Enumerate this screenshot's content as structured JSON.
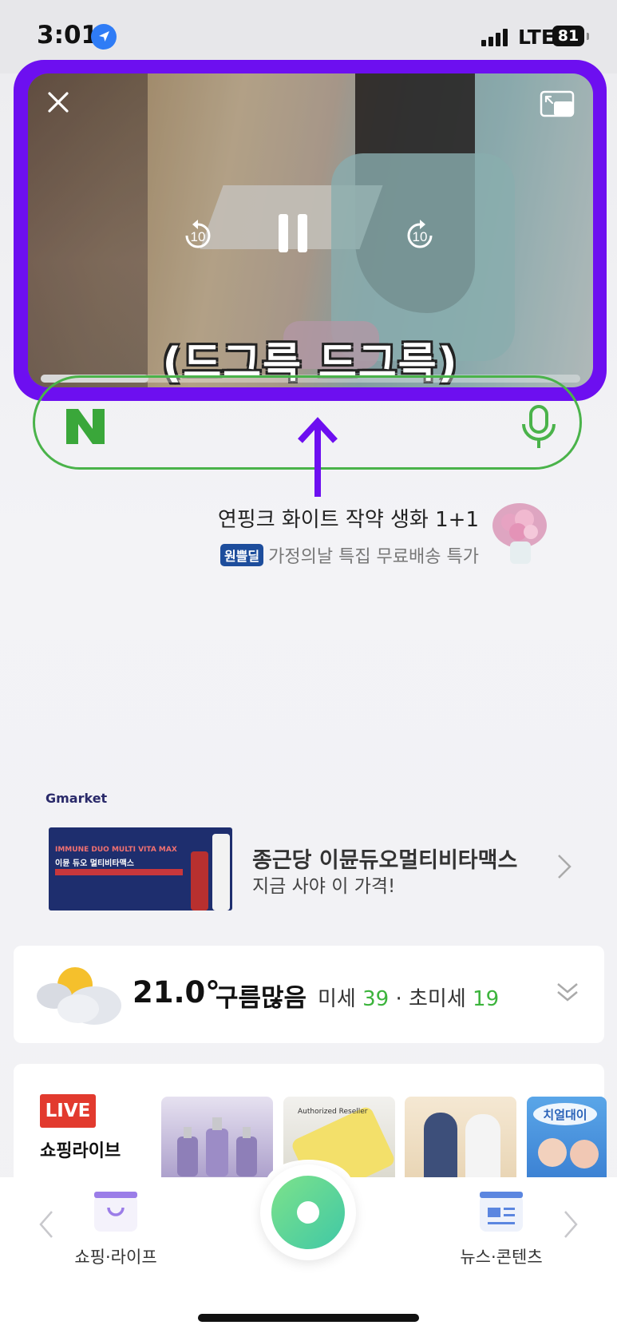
{
  "status_bar": {
    "time": "3:01",
    "network": "LTE",
    "battery": "81"
  },
  "pip": {
    "subtitle": "(드그륵 드그륵)",
    "rewind_label": "10",
    "forward_label": "10",
    "progress": 0.2
  },
  "search": {},
  "promo": {
    "title": "연핑크 화이트 작약 생화 1+1",
    "badge": "원쁠딜",
    "subtitle": "가정의날 특집 무료배송 특가"
  },
  "ad": {
    "brand": "Gmarket",
    "image_line1": "IMMUNE DUO MULTI VITA MAX",
    "image_line2": "이뮨 듀오 멀티비타맥스",
    "title": "종근당 이뮨듀오멀티비타맥스",
    "subtitle": "지금 사야 이 가격!"
  },
  "weather": {
    "temperature": "21.0°",
    "condition": "구름많음",
    "fine_dust_label": "미세",
    "fine_dust_value": "39",
    "separator": "·",
    "ultrafine_dust_label": "초미세",
    "ultrafine_dust_value": "19",
    "good_color": "#3cb43c"
  },
  "live": {
    "badge": "LIVE",
    "title": "쇼핑라이브",
    "thumb2_text": "Authorized Reseller",
    "thumb4_text": "치얼대이"
  },
  "bottom_nav": {
    "left_tab": "쇼핑·라이프",
    "right_tab": "뉴스·콘텐츠"
  },
  "colors": {
    "pip_border": "#6d0ff0",
    "naver_green": "#4ab34a",
    "live_red": "#e23a2e"
  }
}
